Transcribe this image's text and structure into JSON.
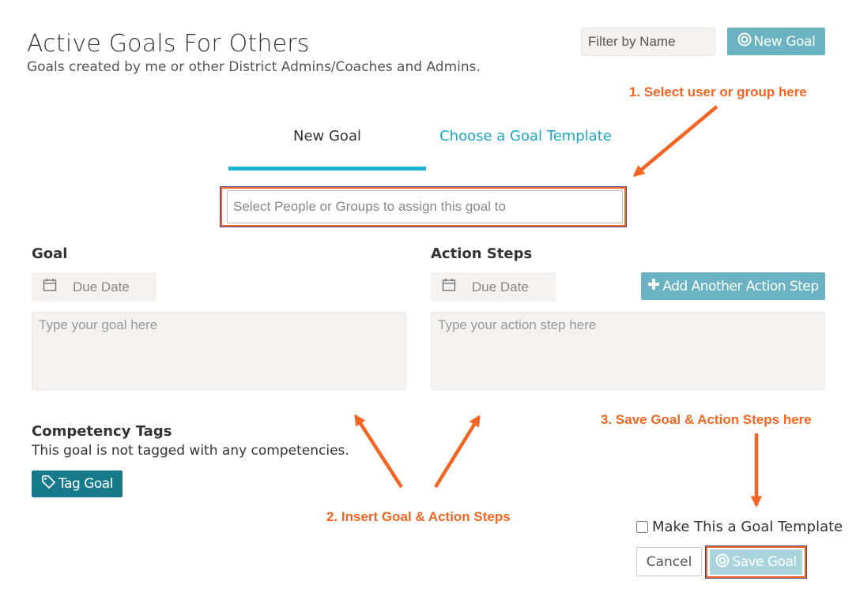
{
  "header": {
    "title": "Active Goals For Others",
    "subtitle": "Goals created by me or other District Admins/Coaches and Admins.",
    "filter_placeholder": "Filter by Name",
    "new_goal_label": "New Goal"
  },
  "tabs": [
    {
      "label": "New Goal",
      "active": true
    },
    {
      "label": "Choose a Goal Template",
      "active": false
    }
  ],
  "assign": {
    "placeholder": "Select People or Groups to assign this goal to"
  },
  "goal": {
    "label": "Goal",
    "due_placeholder": "Due Date",
    "text_placeholder": "Type your goal here"
  },
  "action_steps": {
    "label": "Action Steps",
    "due_placeholder": "Due Date",
    "text_placeholder": "Type your action step here",
    "add_label": "Add Another Action Step"
  },
  "competency": {
    "title": "Competency Tags",
    "description": "This goal is not tagged with any competencies.",
    "tag_button_label": "Tag Goal"
  },
  "footer": {
    "template_checkbox_label": "Make This a Goal Template",
    "template_checked": false,
    "cancel_label": "Cancel",
    "save_label": "Save Goal"
  },
  "annotations": {
    "step1": "1. Select user or group here",
    "step2": "2. Insert Goal & Action Steps",
    "step3": "3. Save Goal & Action Steps here",
    "color": "#f26522"
  },
  "colors": {
    "primary_button": "#6bb3c3",
    "tag_button": "#177a8a",
    "tab_accent": "#1ab3d1",
    "input_bg": "#f4f1ee"
  }
}
